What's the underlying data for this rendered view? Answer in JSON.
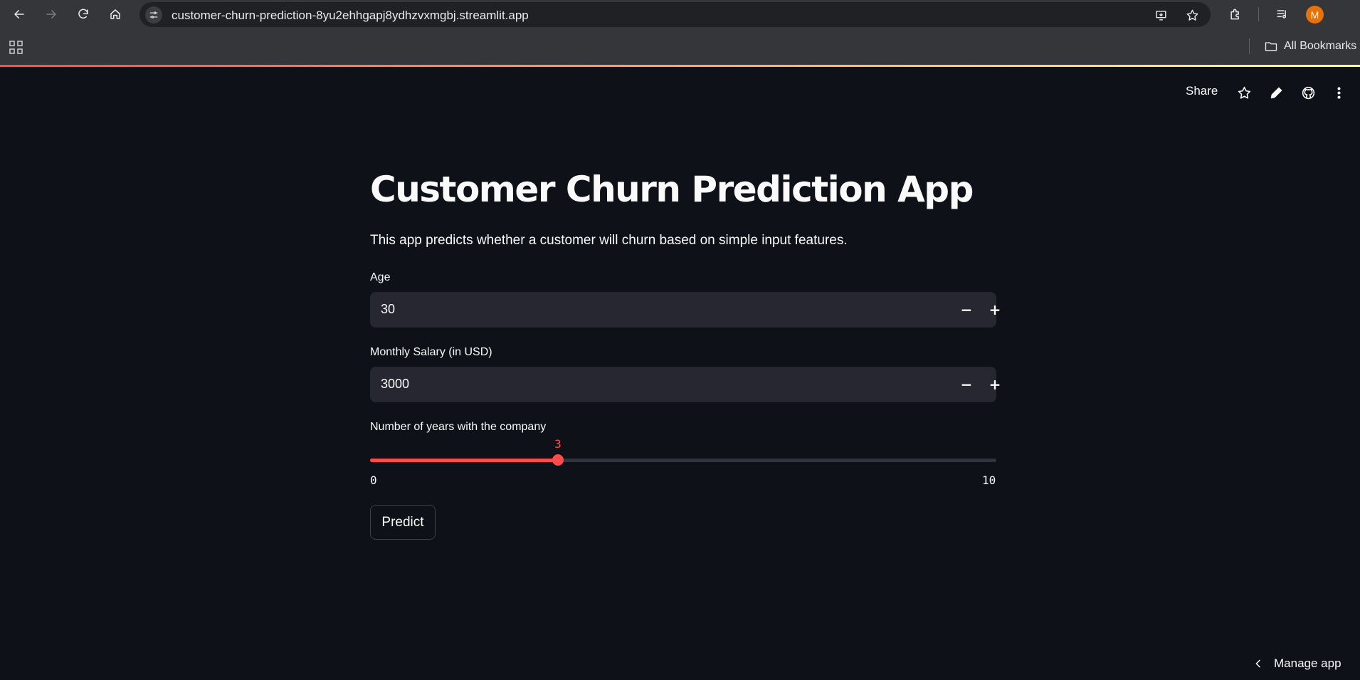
{
  "browser": {
    "url": "customer-churn-prediction-8yu2ehhgapj8ydhzvxmgbj.streamlit.app",
    "avatar_letter": "M",
    "bookmarks_label": "All Bookmarks"
  },
  "toolbar": {
    "share_label": "Share"
  },
  "app": {
    "title": "Customer Churn Prediction App",
    "description": "This app predicts whether a customer will churn based on simple input features.",
    "age": {
      "label": "Age",
      "value": "30"
    },
    "salary": {
      "label": "Monthly Salary (in USD)",
      "value": "3000"
    },
    "years": {
      "label": "Number of years with the company",
      "value": 3,
      "min": 0,
      "max": 10
    },
    "predict_label": "Predict"
  },
  "footer": {
    "manage_label": "Manage app"
  },
  "colors": {
    "accent": "#ff4b4b",
    "background": "#0e1117",
    "input_bg": "#262730"
  }
}
